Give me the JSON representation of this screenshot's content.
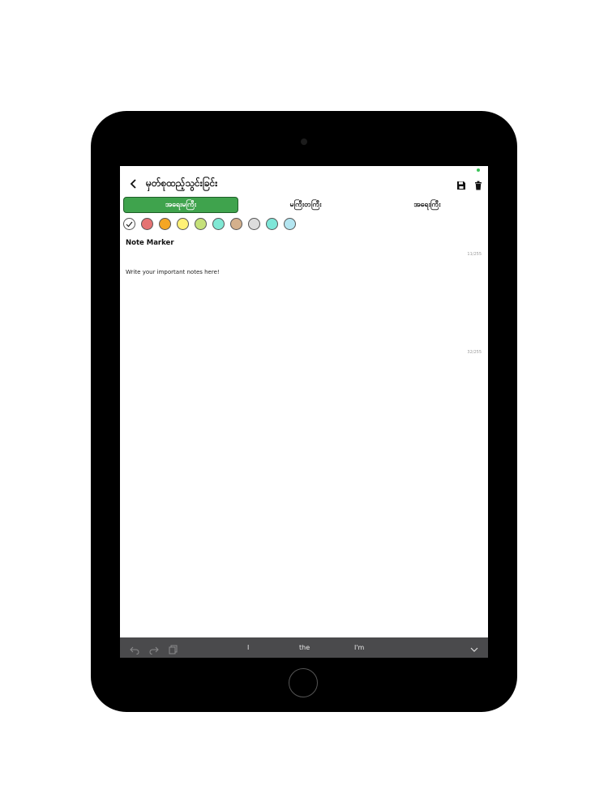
{
  "header": {
    "title": "မှတ်စုထည့်သွင်းခြင်း",
    "back_icon": "chevron-left-icon",
    "save_icon": "save-icon",
    "delete_icon": "trash-icon"
  },
  "tabs": [
    {
      "label": "အရေးမကြီး",
      "active": true
    },
    {
      "label": "မကြီးတကြီး",
      "active": false
    },
    {
      "label": "အရေးကြီး",
      "active": false
    }
  ],
  "colors": {
    "accent": "#3fa34d",
    "swatches": [
      "#ffffff",
      "#e57373",
      "#f5a623",
      "#fff176",
      "#c5e17a",
      "#80e8d4",
      "#d4b08c",
      "#dcdcdc",
      "#7ee6d8",
      "#b3e5f0"
    ],
    "selected_index": 0
  },
  "note": {
    "title": "Note Marker",
    "title_counter": "11/255",
    "body": "Write your important notes here!",
    "body_counter": "32/255"
  },
  "keyboard": {
    "suggestions": [
      "I",
      "the",
      "I'm"
    ]
  }
}
